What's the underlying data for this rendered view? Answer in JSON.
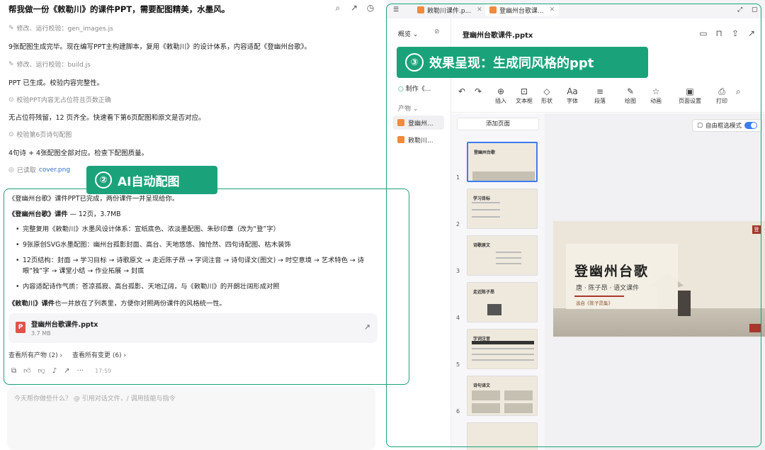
{
  "chat": {
    "title": "帮我做一份《敕勒川》的课件PPT，需要配图精美，水墨风。",
    "steps": [
      {
        "label": "修改、运行校验：gen_images.js",
        "icon": "pencil-icon"
      },
      {
        "label": "修改、运行校验：build.js",
        "icon": "pencil-icon"
      },
      {
        "label": "校验PPT内容无占位符且页数正确",
        "icon": "check-icon"
      },
      {
        "label": "校验第6页诗句配图",
        "icon": "check-icon"
      }
    ],
    "paragraphs": [
      "9张配图生成完毕。现在编写PPT主构建脚本，复用《敕勒川》的设计体系，内容适配《登幽州台歌》。",
      "PPT 已生成。校验内容完整性。",
      "无占位符残留，12 页齐全。快速看下第6页配图和原文是否对应。",
      "4句诗 + 4张配图全部对应。检查下配图质量。"
    ],
    "read_label": "已读取",
    "read_file": "cover.png",
    "result": {
      "intro": "《登幽州台歌》课件PPT已完成，两份课件一并呈现给你。",
      "head_bold": "《登幽州台歌》课件",
      "head_rest": " — 12页，3.7MB",
      "bullets": [
        "完整复用《敕勒川》水墨风设计体系：宣纸底色、浓淡墨配图、朱砂印章（改为“登”字）",
        "9张原创SVG水墨配图：幽州台孤影封面、高台、天地悠悠、独怆然、四句诗配图、枯木装饰",
        "12页结构：封面 → 学习目标 → 诗歌原文 → 走近陈子昂 → 字词注音 → 诗句译文(图文) → 时空意境 → 艺术特色 → 诗眼“独”字 → 课堂小结 → 作业拓展 → 封底",
        "内容适配诗作气质：苍凉孤寂、高台孤影、天地辽阔，与《敕勒川》的开朗壮阔形成对照"
      ],
      "tail_bold": "《敕勒川》课件",
      "tail_rest": "也一并放在了列表里，方便你对照两份课件的风格统一性。"
    },
    "file_card": {
      "name": "登幽州台歌课件.pptx",
      "size": "3.7 MB"
    },
    "links": {
      "artifacts": "查看所有产物 (2) ›",
      "changes": "查看所有变更 (6) ›"
    },
    "time": "17:59",
    "composer_placeholder": "今天帮你做些什么？ @ 引用对话文件，/ 调用技能与指令"
  },
  "badges": {
    "ai": {
      "num": "②",
      "text": "AI自动配图"
    },
    "effect": {
      "num": "③",
      "text": "效果呈现：生成同风格的ppt"
    }
  },
  "preview": {
    "tabs": [
      "敕勒川课件.p...",
      "登幽州台歌课..."
    ],
    "sidebar": {
      "overview": "概览",
      "making": "制作《...",
      "products": "产物",
      "items": [
        "登幽州...",
        "敕勒川..."
      ]
    },
    "doc_title": "登幽州台歌课件.pptx",
    "ribbon": [
      {
        "label": "插入",
        "icon": "plus-circle-icon"
      },
      {
        "label": "文本框",
        "icon": "textbox-icon"
      },
      {
        "label": "形状",
        "icon": "shapes-icon"
      },
      {
        "label": "字体",
        "icon": "font-icon"
      },
      {
        "label": "段落",
        "icon": "paragraph-icon"
      },
      {
        "label": "绘图",
        "icon": "draw-icon"
      },
      {
        "label": "动画",
        "icon": "star-icon"
      },
      {
        "label": "页面设置",
        "icon": "page-setup-icon"
      },
      {
        "label": "打印",
        "icon": "print-icon"
      }
    ],
    "add_page": "添加页面",
    "toggle_label": "自由框选模式",
    "thumb_numbers": [
      "1",
      "2",
      "3",
      "4",
      "5",
      "6"
    ],
    "thumb_titles": [
      "登幽州台歌",
      "学习目标",
      "诗歌原文",
      "走近陈子昂",
      "字词注音",
      "诗句译文"
    ],
    "slide": {
      "title": "登幽州台歌",
      "subtitle": "唐 · 陈子昂 · 语文课件",
      "tag": "选自《陈子昂集》",
      "seal": "登"
    }
  }
}
